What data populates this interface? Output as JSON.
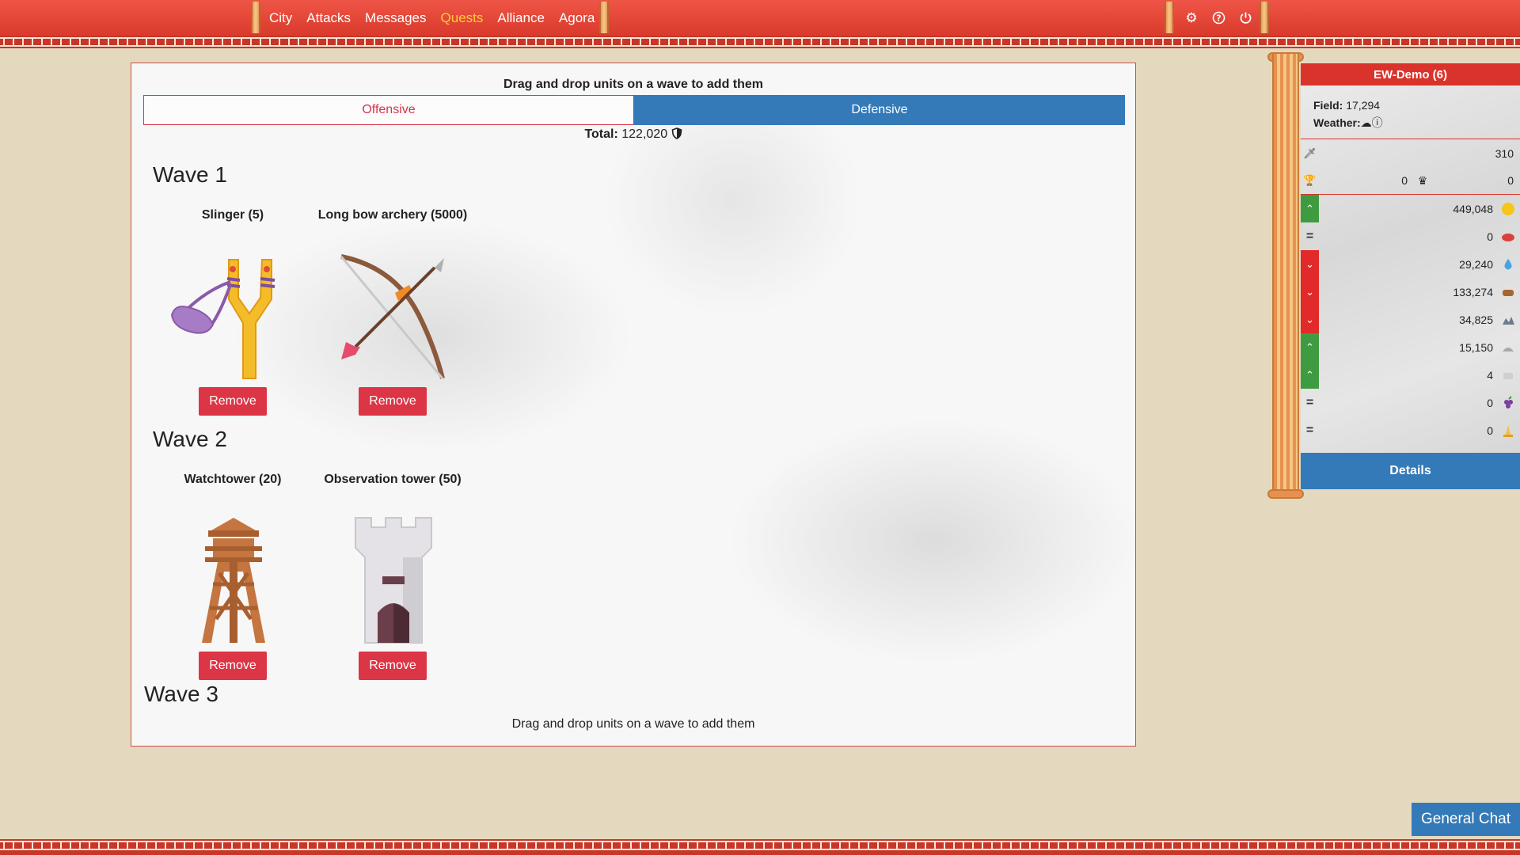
{
  "nav": {
    "items": [
      {
        "label": "City"
      },
      {
        "label": "Attacks"
      },
      {
        "label": "Messages"
      },
      {
        "label": "Quests"
      },
      {
        "label": "Alliance"
      },
      {
        "label": "Agora"
      }
    ],
    "active": "Quests",
    "icons": [
      "gear-icon",
      "help-icon",
      "power-icon"
    ]
  },
  "panel": {
    "title": "Drag and drop units on a wave to add them",
    "tabs": {
      "offensive": "Offensive",
      "defensive": "Defensive"
    },
    "total_label": "Total:",
    "total_value": "122,020",
    "waves": [
      {
        "title": "Wave 1",
        "units": [
          {
            "name": "Slinger (5)",
            "remove": "Remove"
          },
          {
            "name": "Long bow archery (5000)",
            "remove": "Remove"
          }
        ]
      },
      {
        "title": "Wave 2",
        "units": [
          {
            "name": "Watchtower (20)",
            "remove": "Remove"
          },
          {
            "name": "Observation tower (50)",
            "remove": "Remove"
          }
        ]
      },
      {
        "title": "Wave 3",
        "units": []
      }
    ],
    "drop_hint": "Drag and drop units on a wave to add them"
  },
  "side": {
    "city_name": "EW-Demo (6)",
    "field_label": "Field:",
    "field_value": "17,294",
    "weather_label": "Weather:",
    "attack_value": "310",
    "trophy_value": "0",
    "crown_value": "0",
    "resources": [
      {
        "trend": "up",
        "value": "449,048",
        "icon": "gold-icon"
      },
      {
        "trend": "eq",
        "value": "0",
        "icon": "meat-icon"
      },
      {
        "trend": "down",
        "value": "29,240",
        "icon": "water-icon"
      },
      {
        "trend": "down",
        "value": "133,274",
        "icon": "wood-icon"
      },
      {
        "trend": "down",
        "value": "34,825",
        "icon": "stone-icon"
      },
      {
        "trend": "up",
        "value": "15,150",
        "icon": "iron-icon"
      },
      {
        "trend": "up",
        "value": "4",
        "icon": "marble-icon"
      },
      {
        "trend": "eq",
        "value": "0",
        "icon": "grapes-icon"
      },
      {
        "trend": "eq",
        "value": "0",
        "icon": "faith-icon"
      }
    ],
    "details": "Details"
  },
  "chat": {
    "label": "General Chat"
  }
}
